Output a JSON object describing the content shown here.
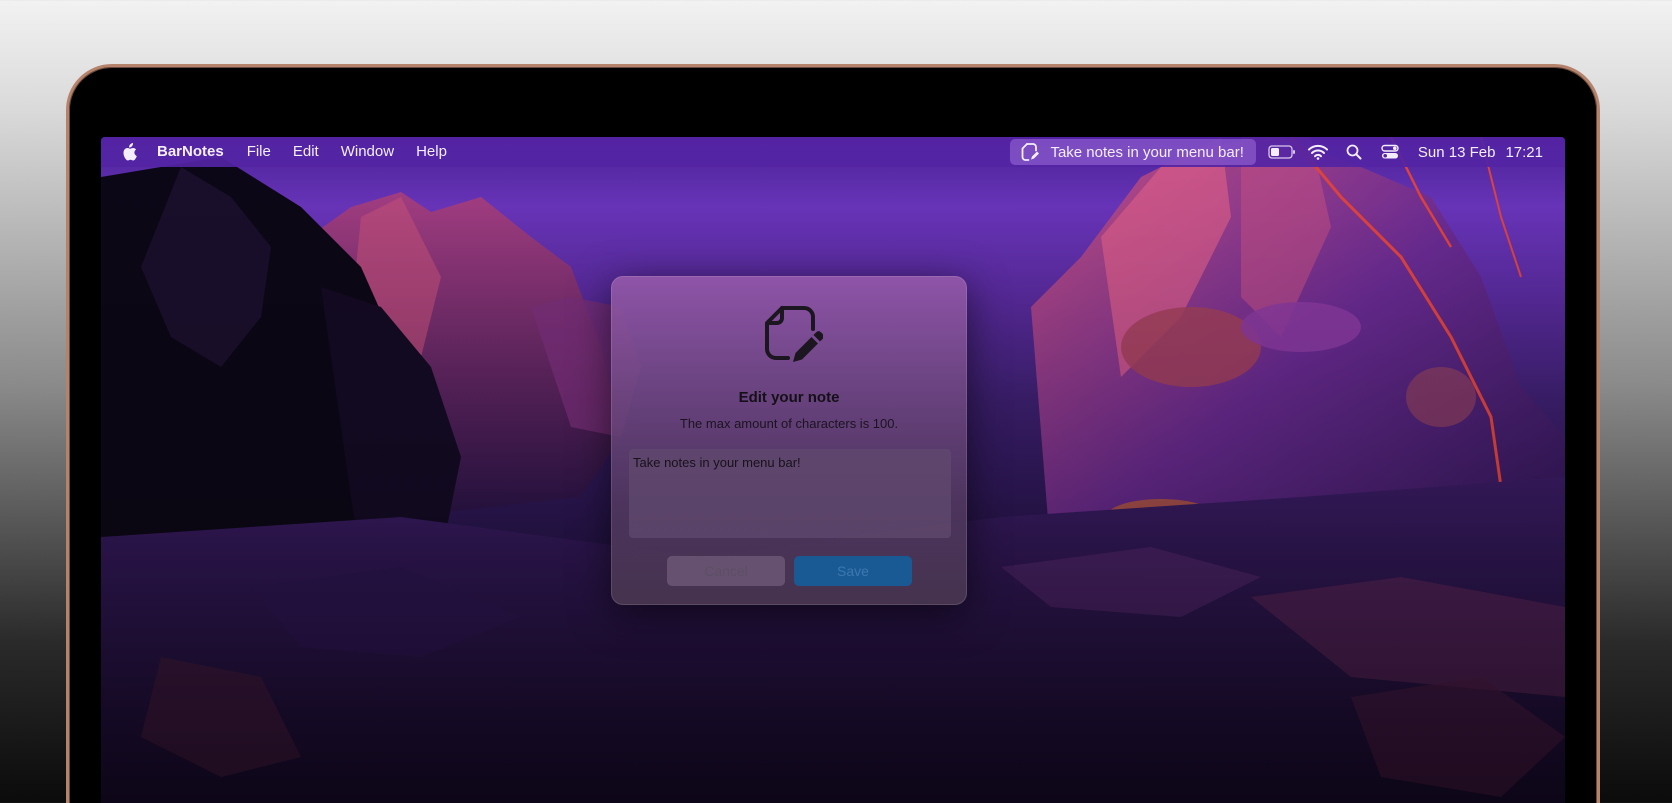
{
  "menubar": {
    "app_name": "BarNotes",
    "items": [
      "File",
      "Edit",
      "Window",
      "Help"
    ],
    "status_note": "Take notes in your menu bar!",
    "date": "Sun 13 Feb",
    "time": "17:21",
    "icons": [
      "apple-logo-icon",
      "note-edit-icon",
      "battery-icon",
      "wifi-icon",
      "search-icon",
      "control-center-icon"
    ]
  },
  "dialog": {
    "icon": "note-edit-icon",
    "title": "Edit your note",
    "subtitle": "The max amount of characters is 100.",
    "note_value": "Take notes in your menu bar!",
    "cancel_label": "Cancel",
    "save_label": "Save"
  },
  "colors": {
    "menubar": "#5424a4",
    "save_button": "#1a5a94"
  }
}
